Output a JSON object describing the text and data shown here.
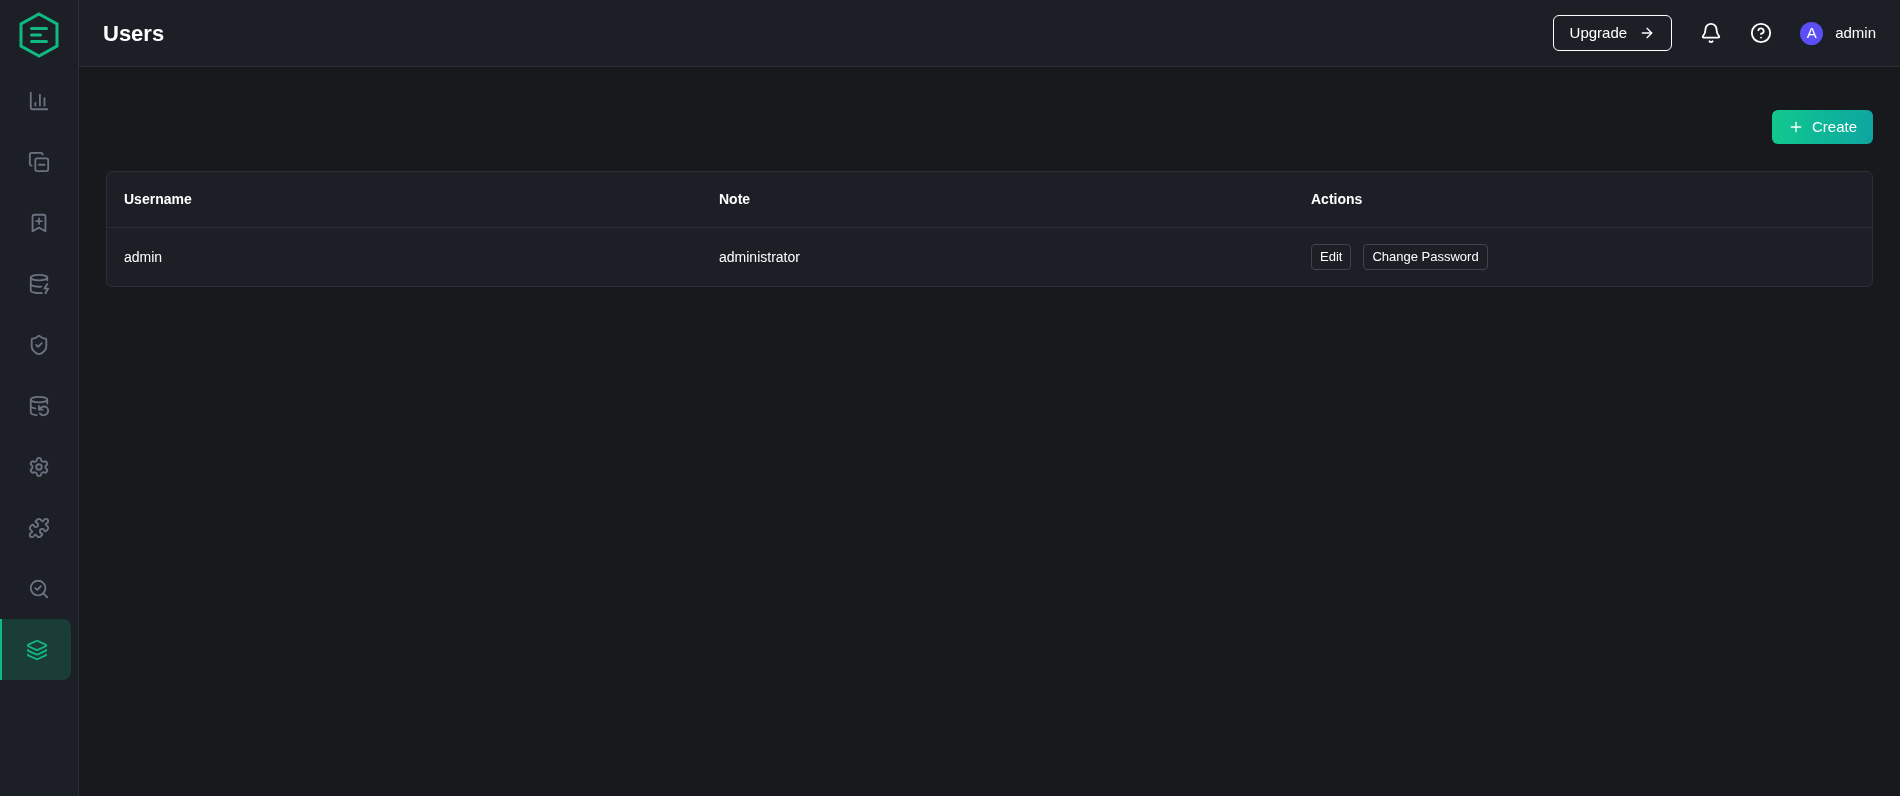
{
  "sidebar": {
    "items": [
      {
        "kind": "chart",
        "selected": false
      },
      {
        "kind": "windows",
        "selected": false
      },
      {
        "kind": "bookmark",
        "selected": false
      },
      {
        "kind": "database-chat",
        "selected": false
      },
      {
        "kind": "shield",
        "selected": false
      },
      {
        "kind": "database-sync",
        "selected": false
      },
      {
        "kind": "gear-list",
        "selected": false
      },
      {
        "kind": "puzzle",
        "selected": false
      },
      {
        "kind": "monitor-search",
        "selected": false
      },
      {
        "kind": "layers",
        "selected": true
      }
    ]
  },
  "header": {
    "title": "Users",
    "upgrade": "Upgrade",
    "avatar": "A",
    "user": "admin"
  },
  "toolbar": {
    "create": "Create"
  },
  "table": {
    "columns": [
      "Username",
      "Note",
      "Actions"
    ],
    "rows": [
      {
        "username": "admin",
        "note": "administrator",
        "actions": [
          "Edit",
          "Change Password"
        ]
      }
    ]
  }
}
